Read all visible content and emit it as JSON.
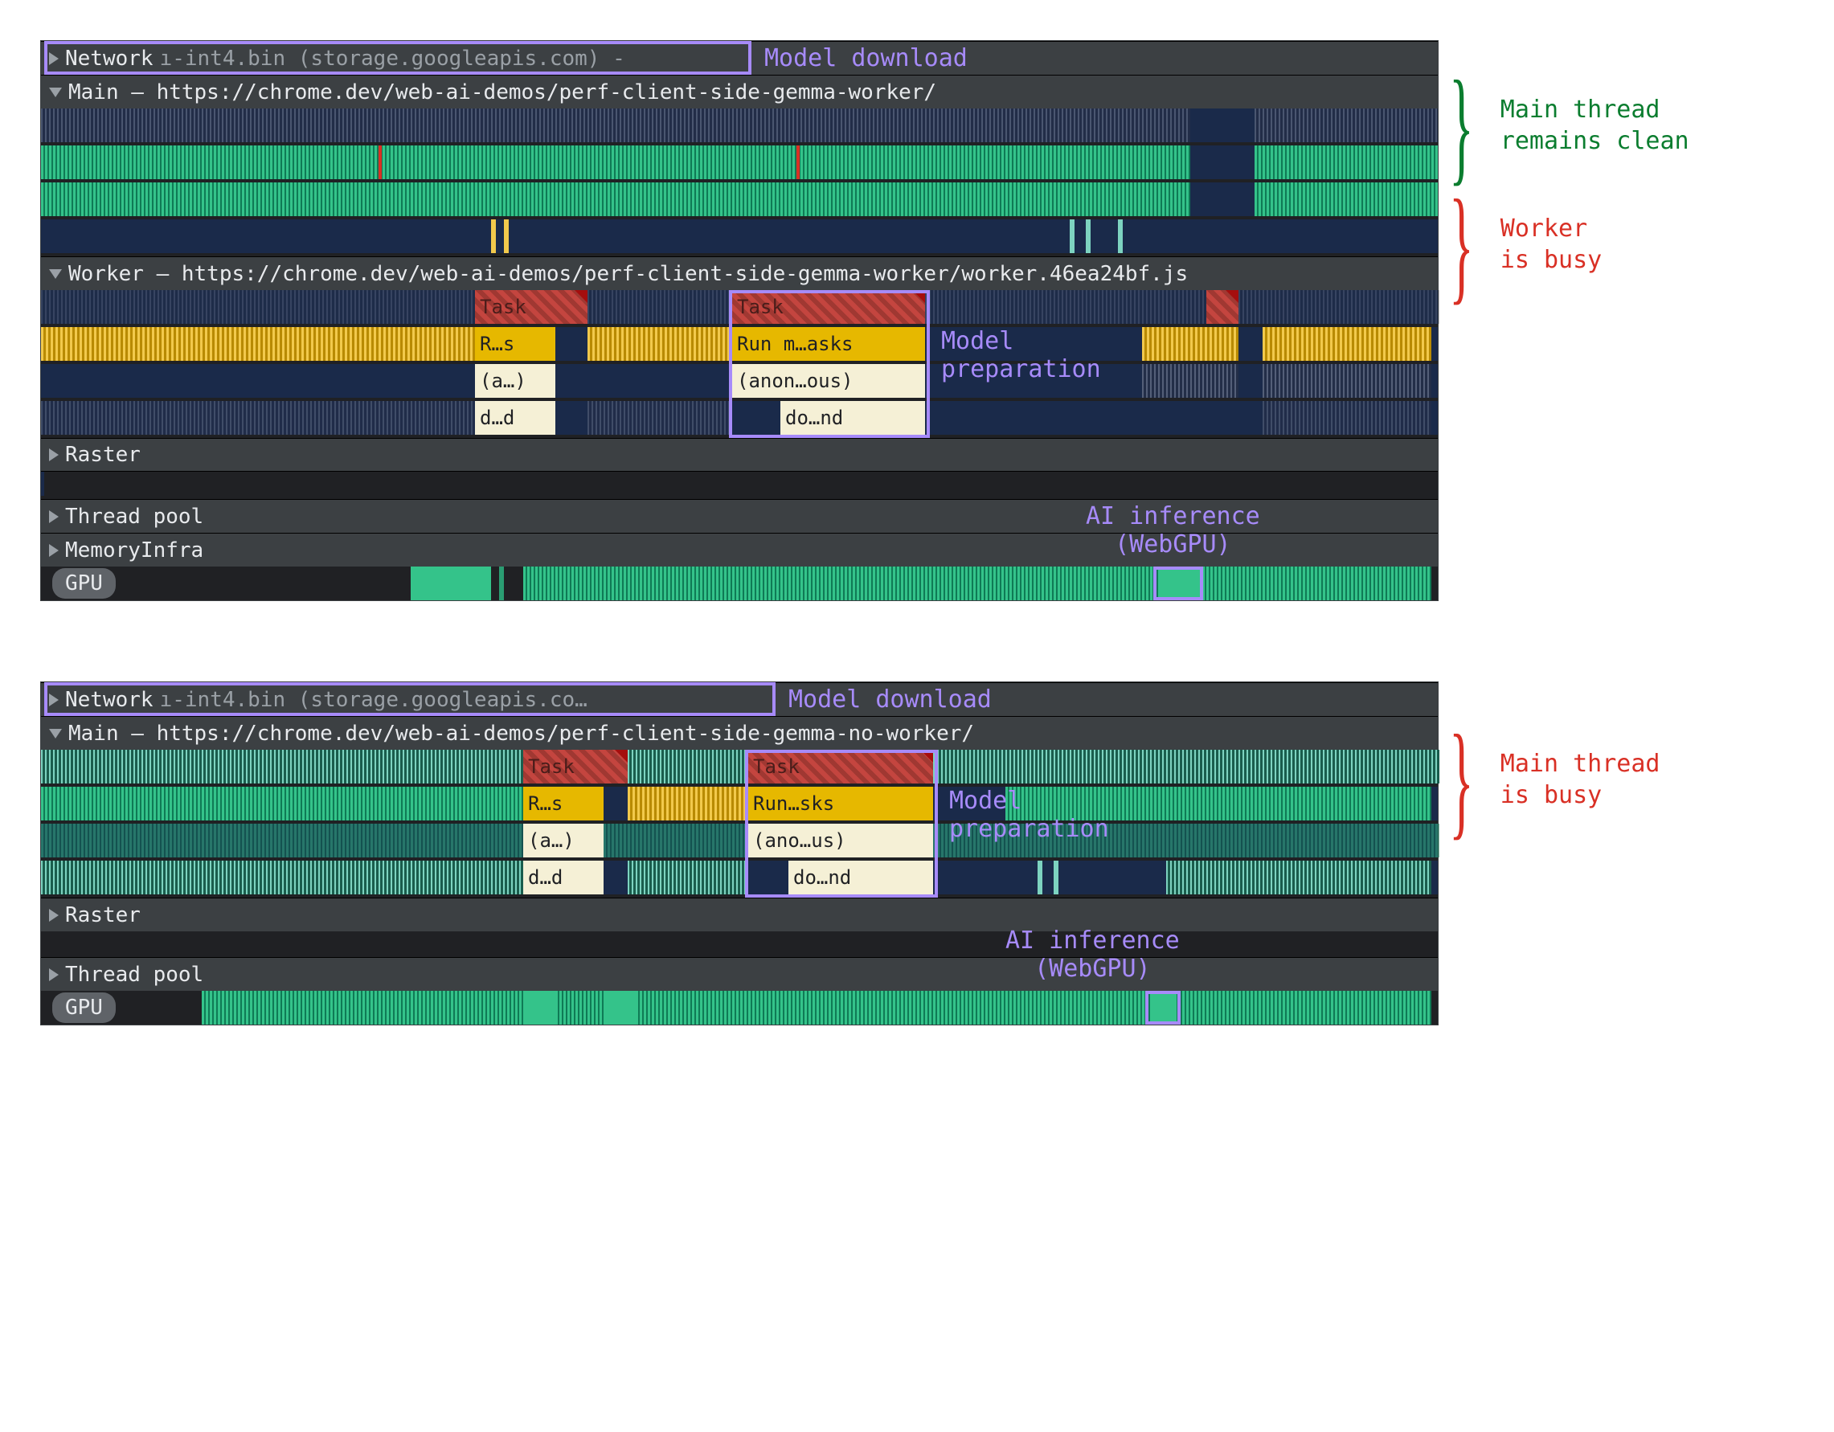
{
  "top": {
    "network_label": "Network",
    "network_file": "ı-int4.bin (storage.googleapis.com) -",
    "main_label": "Main — https://chrome.dev/web-ai-demos/perf-client-side-gemma-worker/",
    "worker_label": "Worker — https://chrome.dev/web-ai-demos/perf-client-side-gemma-worker/worker.46ea24bf.js",
    "raster_label": "Raster",
    "threadpool_label": "Thread pool",
    "memoryinfra_label": "MemoryInfra",
    "gpu_label": "GPU",
    "worker_blocks": {
      "task1": "Task",
      "task2": "Task",
      "rs": "R…s",
      "runmasks": "Run m…asks",
      "a": "(a…)",
      "anonous": "(anon…ous)",
      "dd": "d…d",
      "dond": "do…nd"
    },
    "annotations": {
      "model_download": "Model download",
      "model_preparation": "Model\npreparation",
      "ai_inference": "AI inference\n(WebGPU)"
    },
    "side_notes": {
      "main_clean": "Main thread\nremains clean",
      "worker_busy": "Worker\nis busy"
    }
  },
  "bottom": {
    "network_label": "Network",
    "network_file": "ı-int4.bin (storage.googleapis.co…",
    "main_label": "Main — https://chrome.dev/web-ai-demos/perf-client-side-gemma-no-worker/",
    "raster_label": "Raster",
    "threadpool_label": "Thread pool",
    "gpu_label": "GPU",
    "main_blocks": {
      "task1": "Task",
      "task2": "Task",
      "rs": "R…s",
      "runsks": "Run…sks",
      "a": "(a…)",
      "anous": "(ano…us)",
      "dd": "d…d",
      "dond": "do…nd"
    },
    "annotations": {
      "model_download": "Model download",
      "model_preparation": "Model\npreparation",
      "ai_inference": "AI inference\n(WebGPU)"
    },
    "side_notes": {
      "main_busy": "Main thread\nis busy"
    }
  }
}
